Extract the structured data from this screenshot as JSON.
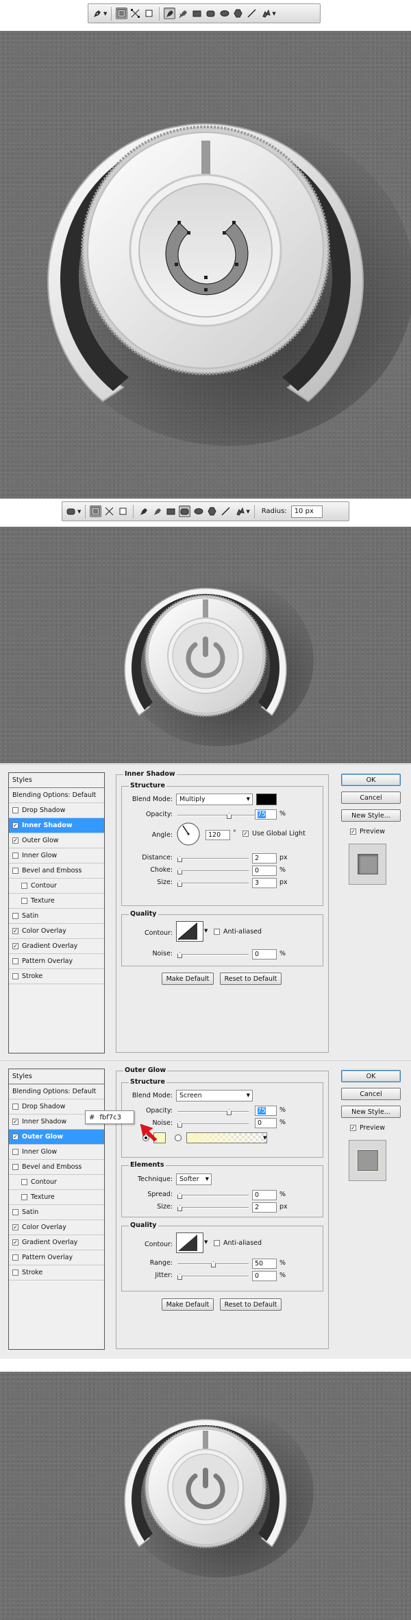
{
  "toolbar1": {
    "tools": [
      "pen-tool-icon",
      "freeform-pen-icon",
      "shape-layers-icon",
      "paths-icon",
      "fill-pixels-icon",
      "pen-icon",
      "freeform-pen-icon",
      "rectangle-icon",
      "rounded-rectangle-icon",
      "ellipse-icon",
      "polygon-icon",
      "line-icon",
      "custom-shape-icon"
    ]
  },
  "toolbar2": {
    "radius_label": "Radius:",
    "radius_value": "10 px"
  },
  "dialog1": {
    "styles": [
      {
        "label": "Styles",
        "checked": null,
        "selected": false,
        "indent": false
      },
      {
        "label": "Blending Options: Default",
        "checked": null,
        "selected": false,
        "indent": false
      },
      {
        "label": "Drop Shadow",
        "checked": false,
        "selected": false,
        "indent": false
      },
      {
        "label": "Inner Shadow",
        "checked": true,
        "selected": true,
        "indent": false
      },
      {
        "label": "Outer Glow",
        "checked": true,
        "selected": false,
        "indent": false
      },
      {
        "label": "Inner Glow",
        "checked": false,
        "selected": false,
        "indent": false
      },
      {
        "label": "Bevel and Emboss",
        "checked": false,
        "selected": false,
        "indent": false
      },
      {
        "label": "Contour",
        "checked": false,
        "selected": false,
        "indent": true
      },
      {
        "label": "Texture",
        "checked": false,
        "selected": false,
        "indent": true
      },
      {
        "label": "Satin",
        "checked": false,
        "selected": false,
        "indent": false
      },
      {
        "label": "Color Overlay",
        "checked": true,
        "selected": false,
        "indent": false
      },
      {
        "label": "Gradient Overlay",
        "checked": true,
        "selected": false,
        "indent": false
      },
      {
        "label": "Pattern Overlay",
        "checked": false,
        "selected": false,
        "indent": false
      },
      {
        "label": "Stroke",
        "checked": false,
        "selected": false,
        "indent": false
      }
    ],
    "title": "Inner Shadow",
    "structure": "Structure",
    "blend_mode_label": "Blend Mode:",
    "blend_mode": "Multiply",
    "shadow_color": "#000000",
    "opacity_label": "Opacity:",
    "opacity": "75",
    "angle_label": "Angle:",
    "angle": "120",
    "angle_unit": "°",
    "global_light": "Use Global Light",
    "distance_label": "Distance:",
    "distance": "2",
    "choke_label": "Choke:",
    "choke": "0",
    "size_label": "Size:",
    "size": "3",
    "quality": "Quality",
    "contour_label": "Contour:",
    "anti_aliased": "Anti-aliased",
    "noise_label": "Noise:",
    "noise": "0",
    "make_default": "Make Default",
    "reset_default": "Reset to Default",
    "ok": "OK",
    "cancel": "Cancel",
    "new_style": "New Style...",
    "preview": "Preview",
    "unit_px": "px",
    "unit_pct": "%"
  },
  "dialog2": {
    "styles": [
      {
        "label": "Styles",
        "checked": null,
        "selected": false,
        "indent": false
      },
      {
        "label": "Blending Options: Default",
        "checked": null,
        "selected": false,
        "indent": false
      },
      {
        "label": "Drop Shadow",
        "checked": false,
        "selected": false,
        "indent": false
      },
      {
        "label": "Inner Shadow",
        "checked": true,
        "selected": false,
        "indent": false
      },
      {
        "label": "Outer Glow",
        "checked": true,
        "selected": true,
        "indent": false
      },
      {
        "label": "Inner Glow",
        "checked": false,
        "selected": false,
        "indent": false
      },
      {
        "label": "Bevel and Emboss",
        "checked": false,
        "selected": false,
        "indent": false
      },
      {
        "label": "Contour",
        "checked": false,
        "selected": false,
        "indent": true
      },
      {
        "label": "Texture",
        "checked": false,
        "selected": false,
        "indent": true
      },
      {
        "label": "Satin",
        "checked": false,
        "selected": false,
        "indent": false
      },
      {
        "label": "Color Overlay",
        "checked": true,
        "selected": false,
        "indent": false
      },
      {
        "label": "Gradient Overlay",
        "checked": true,
        "selected": false,
        "indent": false
      },
      {
        "label": "Pattern Overlay",
        "checked": false,
        "selected": false,
        "indent": false
      },
      {
        "label": "Stroke",
        "checked": false,
        "selected": false,
        "indent": false
      }
    ],
    "title": "Outer Glow",
    "structure": "Structure",
    "blend_mode_label": "Blend Mode:",
    "blend_mode": "Screen",
    "opacity_label": "Opacity:",
    "opacity": "75",
    "noise_label": "Noise:",
    "noise": "0",
    "glow_color": "#fbf7c3",
    "hex_prefix": "#",
    "hex_value": "fbf7c3",
    "elements": "Elements",
    "technique_label": "Technique:",
    "technique": "Softer",
    "spread_label": "Spread:",
    "spread": "0",
    "size_label": "Size:",
    "size": "2",
    "quality": "Quality",
    "contour_label": "Contour:",
    "anti_aliased": "Anti-aliased",
    "range_label": "Range:",
    "range": "50",
    "jitter_label": "Jitter:",
    "jitter": "0",
    "make_default": "Make Default",
    "reset_default": "Reset to Default",
    "ok": "OK",
    "cancel": "Cancel",
    "new_style": "New Style...",
    "preview": "Preview",
    "unit_px": "px",
    "unit_pct": "%"
  },
  "colors": {
    "canvas_bg": "#6f6f6f",
    "selection_blue": "#3399ff",
    "arrow_red": "#e0141c",
    "glow_swatch": "#fbf7c3"
  }
}
